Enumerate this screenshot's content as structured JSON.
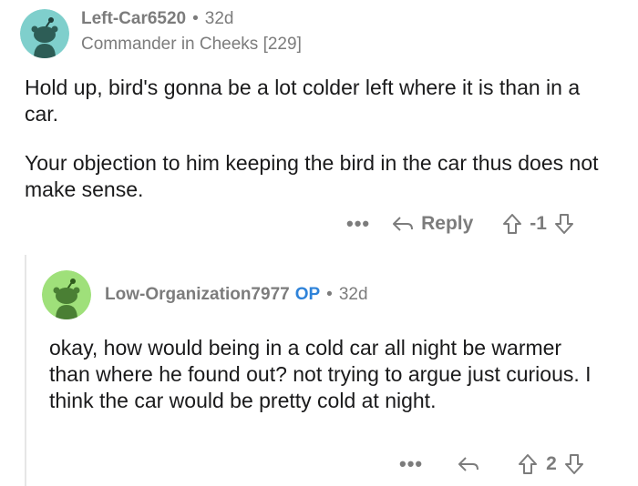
{
  "comment1": {
    "username": "Left-Car6520",
    "age": "32d",
    "flair": "Commander in Cheeks [229]",
    "paragraphs": [
      "Hold up, bird's gonna be a lot colder left where it is than in a car.",
      "Your objection to him keeping the bird in the car thus does not make sense."
    ],
    "actions": {
      "more": "•••",
      "reply_label": "Reply",
      "score": "-1"
    },
    "avatar_color": "#7fcfcc"
  },
  "comment2": {
    "username": "Low-Organization7977",
    "op_label": "OP",
    "age": "32d",
    "paragraphs": [
      "okay, how would being in a cold car all night be warmer than where he found out? not trying to argue just curious. I think the car would be pretty cold at night."
    ],
    "actions": {
      "more": "•••",
      "score": "2"
    },
    "avatar_color": "#9fe07a"
  },
  "separator": "•",
  "colors": {
    "meta": "#7c7c7c",
    "op": "#2f83d9",
    "text": "#1a1a1b",
    "rail": "#e6e6e6"
  }
}
